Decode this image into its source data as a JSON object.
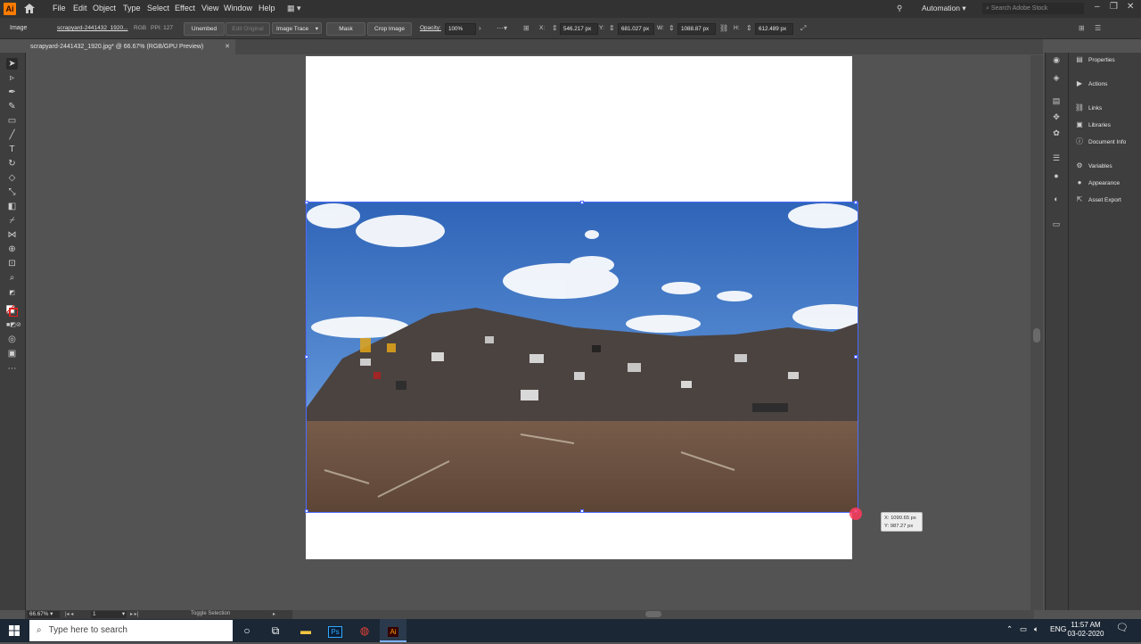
{
  "app": {
    "logo": "Ai",
    "menu": [
      "File",
      "Edit",
      "Object",
      "Type",
      "Select",
      "Effect",
      "View",
      "Window",
      "Help"
    ],
    "workspace": "Automation",
    "search_placeholder": "Search Adobe Stock",
    "brand_color": "#ff7c00"
  },
  "control_bar": {
    "selection_type": "Image",
    "filename": "scrapyard-2441432_1920...",
    "color_mode": "RGB",
    "ppi": "PPI: 127",
    "unembed": "Unembed",
    "edit_original": "Edit Original",
    "image_trace": "Image Trace",
    "mask": "Mask",
    "crop_image": "Crop Image",
    "opacity_label": "Opacity:",
    "opacity_value": "100%",
    "x_label": "X:",
    "x_value": "546.217 px",
    "y_label": "Y:",
    "y_value": "681.027 px",
    "w_label": "W:",
    "w_value": "1088.87 px",
    "h_label": "H:",
    "h_value": "612.489 px"
  },
  "document_tab": {
    "title": "scrapyard-2441432_1920.jpg* @ 66.67% (RGB/GPU Preview)",
    "close": "✕"
  },
  "tooltip": {
    "x": "X: 1090.65 px",
    "y": "Y: 987.27 px"
  },
  "status_bar": {
    "zoom": "66.67%",
    "artboard": "1",
    "tool": "Toggle Selection"
  },
  "right_panel": {
    "items": [
      "Properties",
      "Actions",
      "Links",
      "Libraries",
      "Document Info",
      "Variables",
      "Appearance",
      "Asset Export"
    ]
  },
  "taskbar": {
    "search_placeholder": "Type here to search",
    "lang": "ENG",
    "time": "11:57 AM",
    "date": "03-02-2020"
  }
}
